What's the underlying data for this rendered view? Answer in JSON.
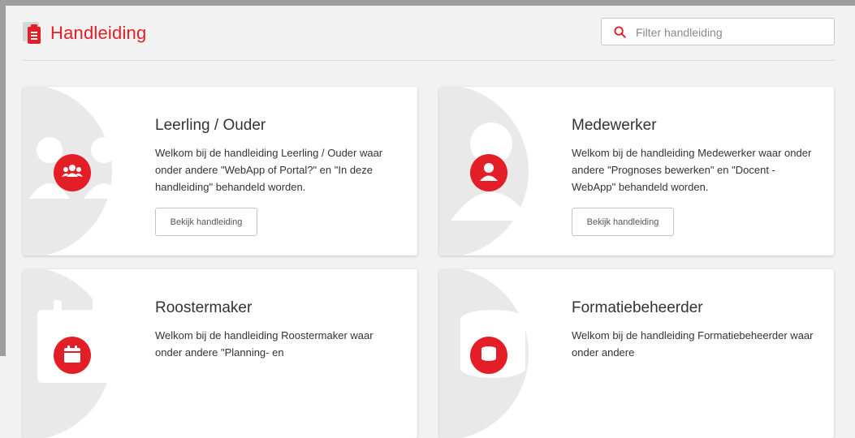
{
  "header": {
    "title": "Handleiding",
    "search_placeholder": "Filter handleiding",
    "search_value": ""
  },
  "colors": {
    "accent": "#e41e26",
    "background": "#f2f2f2",
    "card": "#ffffff"
  },
  "cards": [
    {
      "title": "Leerling / Ouder",
      "description": "Welkom bij de handleiding Leerling / Ouder waar onder andere \"WebApp of Portal?\" en \"In deze handleiding\" behandeld worden.",
      "button_label": "Bekijk handleiding",
      "icon": "users-icon"
    },
    {
      "title": "Medewerker",
      "description": "Welkom bij de handleiding Medewerker waar onder andere \"Prognoses bewerken\" en \"Docent - WebApp\" behandeld worden.",
      "button_label": "Bekijk handleiding",
      "icon": "user-icon"
    },
    {
      "title": "Roostermaker",
      "description": "Welkom bij de handleiding Roostermaker waar onder andere \"Planning- en",
      "icon": "calendar-icon"
    },
    {
      "title": "Formatiebeheerder",
      "description": "Welkom bij de handleiding Formatiebeheerder waar onder andere",
      "icon": "coins-icon"
    }
  ]
}
